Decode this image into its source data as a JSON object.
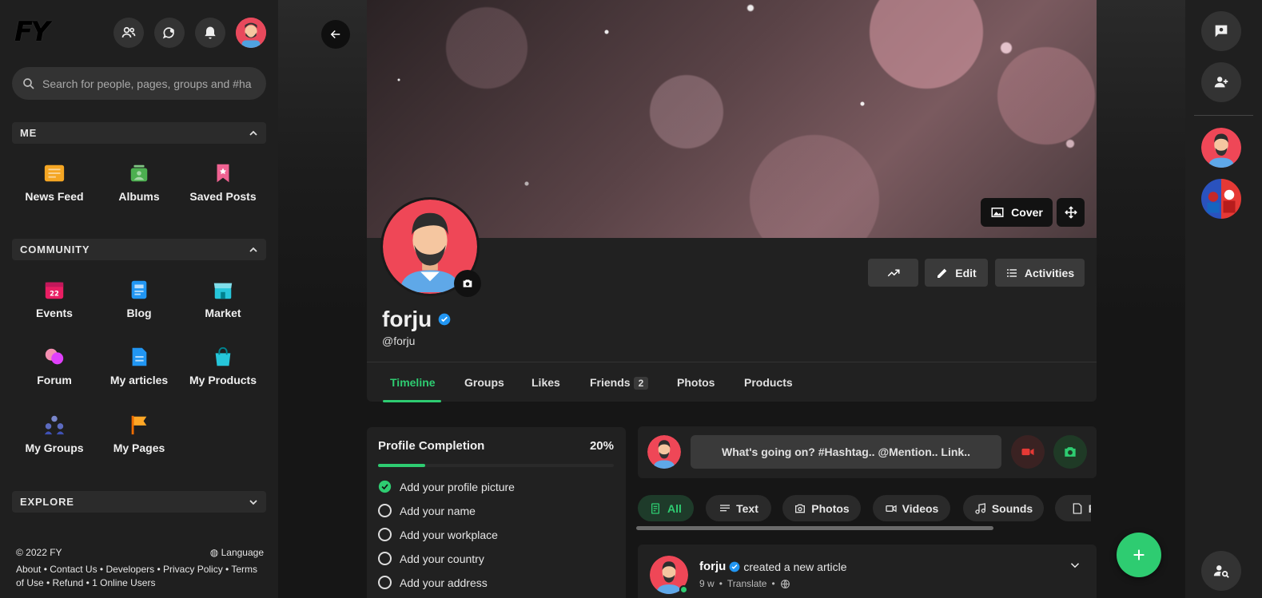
{
  "app": {
    "logo": "FY"
  },
  "search": {
    "placeholder": "Search for people, pages, groups and #ha"
  },
  "sections": {
    "me": "ME",
    "community": "COMMUNITY",
    "explore": "EXPLORE"
  },
  "me_items": [
    {
      "label": "News Feed",
      "icon": "news-feed-icon",
      "color": "#f5a623"
    },
    {
      "label": "Albums",
      "icon": "albums-icon",
      "color": "#4caf50"
    },
    {
      "label": "Saved Posts",
      "icon": "bookmark-icon",
      "color": "#f06292"
    }
  ],
  "community_items": [
    {
      "label": "Events",
      "icon": "calendar-icon",
      "color": "#e91e63"
    },
    {
      "label": "Blog",
      "icon": "blog-icon",
      "color": "#2196f3"
    },
    {
      "label": "Market",
      "icon": "store-icon",
      "color": "#26c6da"
    },
    {
      "label": "Forum",
      "icon": "forum-icon",
      "color": "#e040fb"
    },
    {
      "label": "My articles",
      "icon": "article-icon",
      "color": "#2196f3"
    },
    {
      "label": "My Products",
      "icon": "shopping-bag-icon",
      "color": "#26c6da"
    },
    {
      "label": "My Groups",
      "icon": "groups-icon",
      "color": "#5c6bc0"
    },
    {
      "label": "My Pages",
      "icon": "flag-icon",
      "color": "#ffa726"
    }
  ],
  "footer": {
    "copyright": "© 2022 FY",
    "language": "Language",
    "links": "About • Contact Us • Developers • Privacy Policy • Terms of Use • Refund • 1 Online Users"
  },
  "cover": {
    "cover_button": "Cover"
  },
  "profile": {
    "name": "forju",
    "handle": "@forju",
    "verified": true,
    "edit_label": "Edit",
    "activities_label": "Activities"
  },
  "tabs": [
    {
      "label": "Timeline",
      "active": true
    },
    {
      "label": "Groups"
    },
    {
      "label": "Likes"
    },
    {
      "label": "Friends",
      "badge": "2"
    },
    {
      "label": "Photos"
    },
    {
      "label": "Products"
    }
  ],
  "profile_completion": {
    "title": "Profile Completion",
    "percent": "20%",
    "progress": 0.2,
    "items": [
      {
        "label": "Add your profile picture",
        "done": true
      },
      {
        "label": "Add your name",
        "done": false
      },
      {
        "label": "Add your workplace",
        "done": false
      },
      {
        "label": "Add your country",
        "done": false
      },
      {
        "label": "Add your address",
        "done": false
      }
    ]
  },
  "composer": {
    "placeholder": "What's going on? #Hashtag.. @Mention.. Link.."
  },
  "filters": [
    {
      "label": "All",
      "active": true
    },
    {
      "label": "Text"
    },
    {
      "label": "Photos"
    },
    {
      "label": "Videos"
    },
    {
      "label": "Sounds"
    },
    {
      "label": "F"
    }
  ],
  "post": {
    "author": "forju",
    "action": "created a new article",
    "time": "9 w",
    "translate": "Translate"
  },
  "colors": {
    "accent": "#2ecc71",
    "bg": "#161616",
    "panel": "#212121"
  }
}
